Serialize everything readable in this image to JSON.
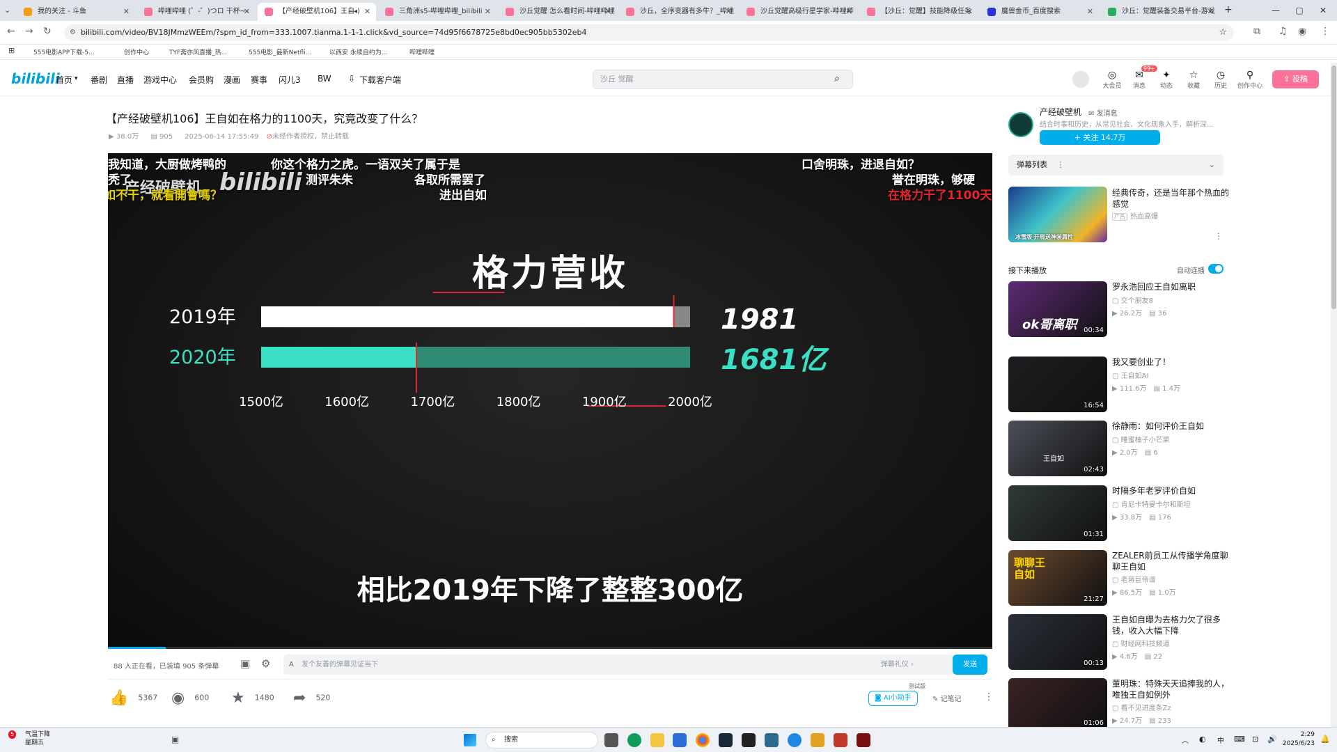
{
  "browser": {
    "tabs": [
      {
        "label": "我的关注 - 斗鱼"
      },
      {
        "label": "哔哩哔哩 (゜-゜)つロ 干杯~-"
      },
      {
        "label": "【产经破壁机106】王自"
      },
      {
        "label": "三角洲s5-哔哩哔哩_bilibili"
      },
      {
        "label": "沙丘觉醒 怎么看时间-哔哩哔哩"
      },
      {
        "label": "沙丘，全序变器有多牛？_哔哩"
      },
      {
        "label": "沙丘觉醒高级行星学家-哔哩哔"
      },
      {
        "label": "【沙丘：觉醒】技能降级任务"
      },
      {
        "label": "魔兽金币_百度搜索"
      },
      {
        "label": "沙丘：觉醒装备交易平台-游戏"
      }
    ],
    "new_tab": "+",
    "window_controls": {
      "minimize": "—",
      "maximize": "▢",
      "close": "✕"
    },
    "url": "bilibili.com/video/BV18JMmzWEEm/?spm_id_from=333.1007.tianma.1-1-1.click&vd_source=74d95f6678725e8bd0ec905bb5302eb4",
    "bookmarks": [
      "555电影APP下载-5...",
      "创作中心",
      "TYF斋亦风直播_热...",
      "555电影_最新Netfli...",
      "以西安 永续自约为...",
      "哔哩哔哩"
    ]
  },
  "site": {
    "logo": "bilibili",
    "nav": [
      "首页",
      "番剧",
      "直播",
      "游戏中心",
      "会员购",
      "漫画",
      "赛事",
      "闪儿3",
      "BW",
      "下载客户端"
    ],
    "search_placeholder": "沙丘 觉醒",
    "top_icons": [
      {
        "label": "大会员",
        "icon": "vip-icon",
        "glyph": "◎"
      },
      {
        "label": "消息",
        "icon": "message-icon",
        "glyph": "✉",
        "badge": "99+"
      },
      {
        "label": "动态",
        "icon": "dynamic-icon",
        "glyph": "✦"
      },
      {
        "label": "收藏",
        "icon": "favorite-icon",
        "glyph": "☆"
      },
      {
        "label": "历史",
        "icon": "history-icon",
        "glyph": "◷"
      },
      {
        "label": "创作中心",
        "icon": "creator-icon",
        "glyph": "⚲"
      }
    ],
    "upload_label": "投稿"
  },
  "video": {
    "title": "【产经破壁机106】王自如在格力的1100天，究竟改变了什么？",
    "views": "38.0万",
    "danmaku_count": "905",
    "date": "2025-06-14 17:55:49",
    "copyright": "未经作者授权，禁止转载",
    "frame": {
      "watermark": "产经破壁机",
      "bili_wm": "bilibili",
      "danmaku": [
        {
          "text": "我知道，大厨做烤鸭的",
          "color": "#ffffff"
        },
        {
          "text": "你这个格力之虎。一语双关了属于是",
          "color": "#ffffff"
        },
        {
          "text": "口舍明珠，进退自如？",
          "color": "#ffffff"
        },
        {
          "text": "秃了",
          "color": "#ffffff"
        },
        {
          "text": "测评朱朱",
          "color": "#ffffff"
        },
        {
          "text": "各取所需罢了",
          "color": "#ffffff"
        },
        {
          "text": "誉在明珠，够硬",
          "color": "#ffffff"
        },
        {
          "text": "进出自如",
          "color": "#ffffff"
        },
        {
          "text": "如不干，就看開會嗎？",
          "color": "#e6d100"
        },
        {
          "text": "在格力干了1100天",
          "color": "#e3262e"
        }
      ],
      "chart_title": "格力营收",
      "subtitle": "相比2019年下降了整整300亿"
    }
  },
  "chart_data": {
    "type": "bar",
    "title": "格力营收",
    "orientation": "horizontal",
    "categories": [
      "2019年",
      "2020年"
    ],
    "values": [
      1981,
      1681
    ],
    "value_labels": [
      "1981",
      "1681亿"
    ],
    "xlim": [
      1500,
      2000
    ],
    "xticks": [
      "1500亿",
      "1600亿",
      "1700亿",
      "1800亿",
      "1900亿",
      "2000亿"
    ],
    "xtick_values": [
      1500,
      1600,
      1700,
      1800,
      1900,
      2000
    ],
    "colors": {
      "2019年": "#ffffff",
      "2020年": "#39e0c3",
      "remainder": "#2e8a72",
      "marker": "#e3262e"
    }
  },
  "player_bar": {
    "watching": "88 人正在看，已装填 905 条弹幕",
    "input_placeholder": "发个友善的弹幕见证当下",
    "etiquette": "弹幕礼仪 ›",
    "send": "发送"
  },
  "actions": {
    "like": "5367",
    "coin": "600",
    "fav": "1480",
    "share": "520",
    "ai_label": "AI小助手",
    "ai_badge": "测试版",
    "notes": "记笔记"
  },
  "uploader": {
    "name": "产经破壁机",
    "message": "发消息",
    "desc": "结合时事和历史，从常见社会、文化现象入手，解析深...",
    "follow": "+ 关注 14.7万"
  },
  "danmaku_list": {
    "label": "弹幕列表",
    "more": "⋮"
  },
  "ad": {
    "title": "经典传奇，还是当年那个热血的感觉",
    "tag": "广告",
    "sponsor": "热血高爆",
    "thumb_caption": "冰雪版·开局送神装属性"
  },
  "autoplay": {
    "label": "接下来播放",
    "toggle_label": "自动连播",
    "on": true
  },
  "recommendations": [
    {
      "title": "罗永浩回应王自如离职",
      "up": "交个朋友8",
      "views": "26.2万",
      "danmaku": "36",
      "duration": "00:34",
      "thumb_text": "ok哥离职",
      "bg": "#5c2a73"
    },
    {
      "title": "我又要创业了！",
      "up": "王自如AI",
      "views": "111.6万",
      "danmaku": "1.4万",
      "duration": "16:54",
      "thumb_text": "",
      "bg": "#1e1e22"
    },
    {
      "title": "徐静雨：如何评价王自如",
      "up": "睡蜜柚子小芒果",
      "views": "2.0万",
      "danmaku": "6",
      "duration": "02:43",
      "thumb_text": "王自如",
      "bg": "#4a4e57"
    },
    {
      "title": "时隔多年老罗评价自如",
      "up": "肯尼卡特曼卡尔和斯坦",
      "views": "33.8万",
      "danmaku": "176",
      "duration": "01:31",
      "thumb_text": "",
      "bg": "#2f3a33"
    },
    {
      "title": "ZEALER前员工从传播学角度聊聊王自如",
      "up": "老蒋巨帝谱",
      "views": "86.5万",
      "danmaku": "1.0万",
      "duration": "21:27",
      "thumb_text": "聊聊王自如",
      "bg": "#6b4a2e"
    },
    {
      "title": "王自如自曝为去格力欠了很多钱，收入大幅下降",
      "up": "财经网科技频道",
      "views": "4.6万",
      "danmaku": "22",
      "duration": "00:13",
      "thumb_text": "",
      "bg": "#2a2f38"
    },
    {
      "title": "董明珠：特殊天天追捧我的人，唯独王自如例外",
      "up": "看不见进度条Zz",
      "views": "24.7万",
      "danmaku": "233",
      "duration": "01:06",
      "thumb_text": "",
      "bg": "#3a2224"
    }
  ],
  "taskbar": {
    "weather_badge": "5",
    "weather": "气温下降",
    "weather_day": "星期五",
    "search": "搜索",
    "time": "2:29",
    "date": "2025/6/23",
    "lang": "中"
  }
}
